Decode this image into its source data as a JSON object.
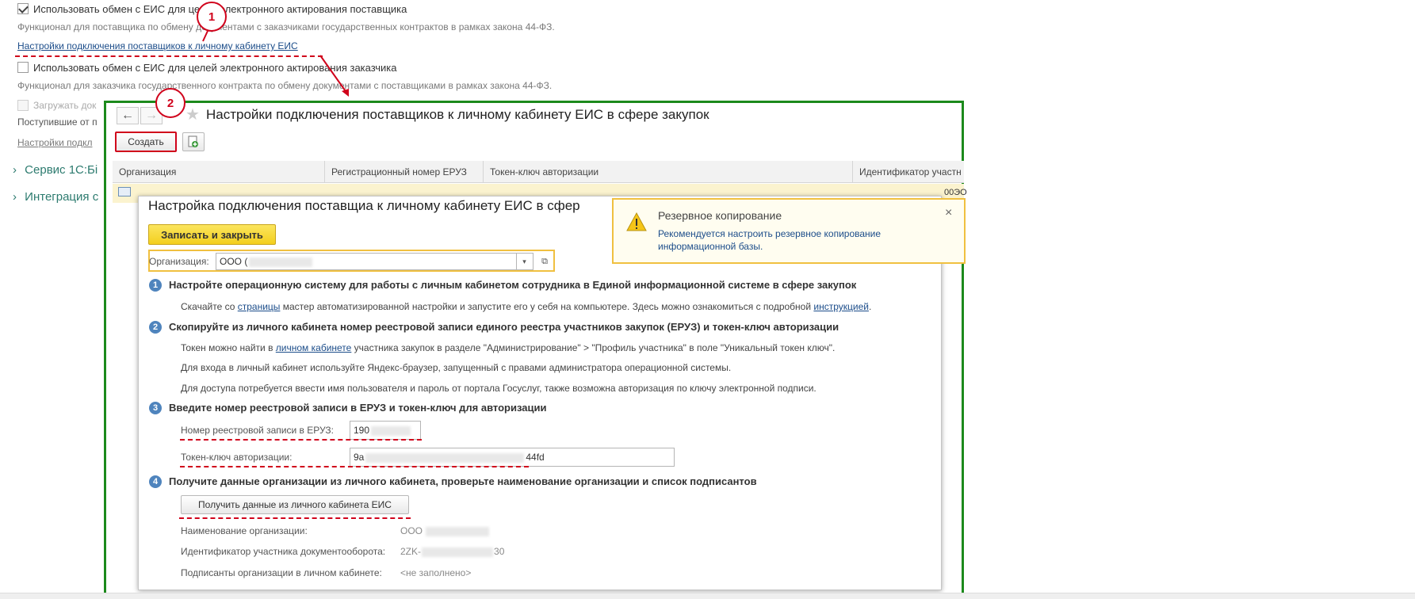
{
  "background": {
    "use_exchange_supplier": "Использовать обмен с ЕИС для целей электронного актирования поставщика",
    "supplier_desc": "Функционал для поставщика по обмену документами с заказчиками государственных контрактов в рамках закона 44-ФЗ.",
    "supplier_settings_link": "Настройки подключения поставщиков к личному кабинету ЕИС",
    "use_exchange_customer": "Использовать обмен с ЕИС для целей электронного актирования заказчика",
    "customer_desc": "Функционал для заказчика государственного контракта по обмену документами с поставщиками в рамках закона 44-ФЗ.",
    "load_docs": "Загружать док",
    "received_from": "Поступившие от п",
    "settings_link2": "Настройки подкл",
    "sections": [
      {
        "label": "Сервис 1С:Бі"
      },
      {
        "label": "Интеграция с"
      }
    ]
  },
  "markers": {
    "one": "1",
    "two": "2"
  },
  "list_window": {
    "back_icon": "arrow-left-icon",
    "forward_icon": "arrow-right-icon",
    "star_icon": "star-icon",
    "title": "Настройки подключения поставщиков к личному кабинету ЕИС в сфере закупок",
    "create_button": "Создать",
    "columns": [
      "Организация",
      "Регистрационный номер ЕРУЗ",
      "Токен-ключ авторизации",
      "Идентификатор участн"
    ],
    "row_id_partial": "00ЭО"
  },
  "form": {
    "title": "Настройка подключения поставщиа к личному кабинету ЕИС в сфер",
    "save_close": "Записать и закрыть",
    "org_label": "Организация:",
    "org_value": "ООО (",
    "steps": [
      {
        "num": "1",
        "title": "Настройте операционную систему для работы с личным кабинетом сотрудника в Единой информационной системе в сфере закупок",
        "line1_before": "Скачайте со ",
        "line1_link": "страницы",
        "line1_after": " мастер автоматизированной настройки и запустите его у себя на компьютере. Здесь можно ознакомиться с подробной ",
        "line1_link2": "инструкцией",
        "line1_end": "."
      },
      {
        "num": "2",
        "title": "Скопируйте из личного кабинета номер реестровой записи единого реестра участников закупок (ЕРУЗ) и токен-ключ авторизации",
        "line1_before": "Токен можно найти в ",
        "line1_link": "личном кабинете",
        "line1_after": " участника закупок в разделе \"Администрирование\" > \"Профиль участника\" в поле \"Уникальный токен ключ\".",
        "line2": "Для входа в личный кабинет используйте Яндекс-браузер, запущенный с правами администратора операционной системы.",
        "line3": "Для доступа потребуется ввести имя пользователя и пароль от портала Госуслуг, также возможна авторизация по ключу электронной подписи."
      },
      {
        "num": "3",
        "title": "Введите номер реестровой записи в ЕРУЗ и токен-ключ для авторизации",
        "eruz_label": "Номер реестровой записи в ЕРУЗ:",
        "eruz_value": "190",
        "token_label": "Токен-ключ авторизации:",
        "token_prefix": "9a",
        "token_suffix": "44fd"
      },
      {
        "num": "4",
        "title": "Получите данные организации из личного кабинета, проверьте наименование организации и список подписантов",
        "get_button": "Получить данные из личного кабинета ЕИС",
        "org_name_label": "Наименование организации:",
        "org_name_value": "ООО",
        "edo_label": "Идентификатор участника документооборота:",
        "edo_prefix": "2ZK-",
        "edo_suffix": "30",
        "signers_label": "Подписанты организации в личном кабинете:",
        "signers_value": "<не заполнено>"
      }
    ]
  },
  "notification": {
    "icon": "warning-icon",
    "title": "Резервное копирование",
    "text_line1": "Рекомендуется настроить резервное копирование",
    "text_line2": "информационной базы.",
    "close": "×"
  },
  "colors": {
    "highlight_red": "#d0021b",
    "frame_green": "#1c8a1c",
    "accent_yellow": "#f3cf1d",
    "step_blue": "#4f84bd",
    "section_teal": "#2d7b6f"
  }
}
